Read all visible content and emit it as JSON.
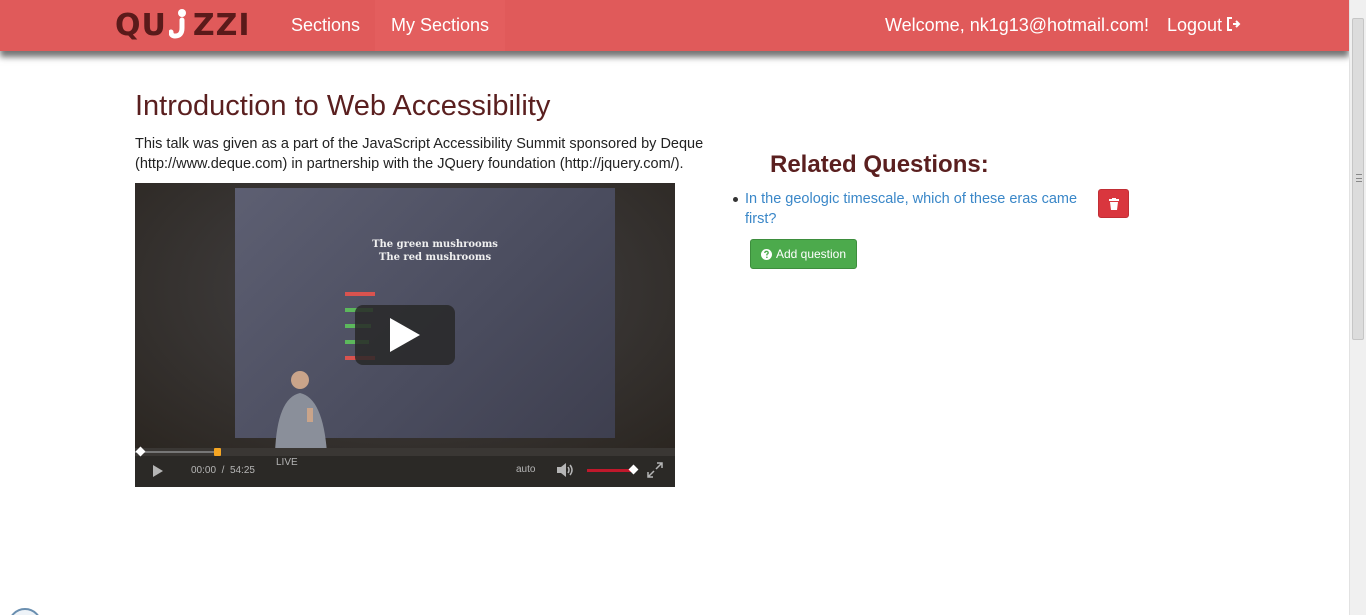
{
  "app": {
    "logo_left": "QU",
    "logo_right": "ZZI"
  },
  "nav": {
    "sections": "Sections",
    "my_sections": "My Sections",
    "welcome": "Welcome, nk1g13@hotmail.com!",
    "logout": "Logout"
  },
  "main": {
    "title": "Introduction to Web Accessibility",
    "description": "This talk was given as a part of the JavaScript Accessibility Summit sponsored by Deque (http://www.deque.com) in partnership with the JQuery foundation (http://jquery.com/)."
  },
  "video": {
    "slide_line1": "The green mushrooms",
    "slide_line2": "The red mushrooms",
    "current_time": "00:00",
    "separator": "/",
    "duration": "54:25",
    "live_label": "LIVE",
    "quality": "auto",
    "progress_fraction": 0.0,
    "volume_fraction": 0.9
  },
  "related": {
    "title": "Related Questions:",
    "questions": [
      {
        "text": "In the geologic timescale, which of these eras came first?"
      }
    ],
    "add_label": "Add question"
  },
  "colors": {
    "navbar": "#e05a5a",
    "title": "#5a1f1f",
    "link": "#3a87c8",
    "danger": "#d9363e",
    "success": "#4caa4c"
  },
  "icons": {
    "logout": "sign-out-icon",
    "delete": "trash-icon",
    "add": "question-circle-icon",
    "play": "play-icon",
    "volume": "volume-icon",
    "fullscreen": "fullscreen-icon"
  }
}
